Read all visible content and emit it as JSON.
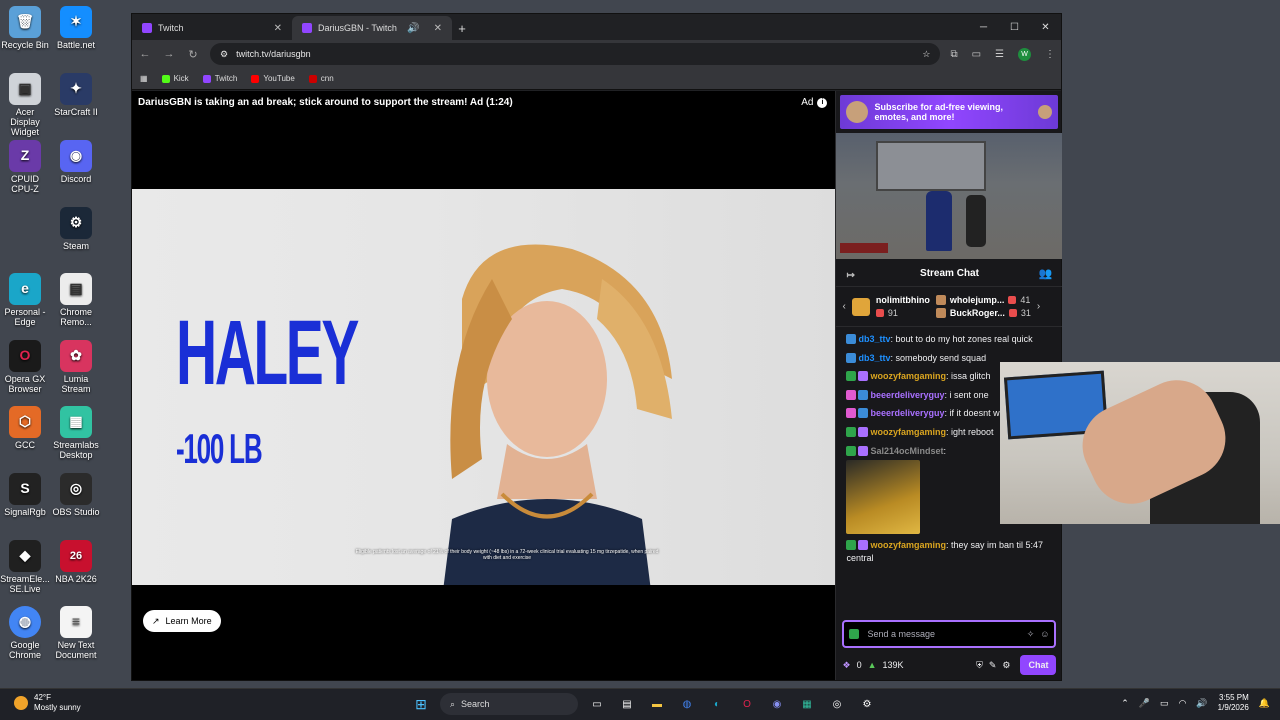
{
  "desktop": {
    "icons": [
      {
        "label": "Recycle Bin",
        "color": "#5aa0d8",
        "glyph": "🗑"
      },
      {
        "label": "Battle.net",
        "color": "#148eff",
        "glyph": "✶"
      },
      {
        "label": "Acer Display Widget",
        "color": "#cfd3d8",
        "glyph": "▣"
      },
      {
        "label": "StarCraft II",
        "color": "#2a3b66",
        "glyph": "✦"
      },
      {
        "label": "CPUID CPU-Z",
        "color": "#6a3aa8",
        "glyph": "Z"
      },
      {
        "label": "Discord",
        "color": "#5865f2",
        "glyph": "◉"
      },
      {
        "label": "Steam",
        "color": "#1b2838",
        "glyph": "⚙"
      },
      {
        "label": "Personal - Edge",
        "color": "#1aa6c9",
        "glyph": "e"
      },
      {
        "label": "Chrome Remo...",
        "color": "#ececec",
        "glyph": "▤"
      },
      {
        "label": "Opera GX Browser",
        "color": "#1a1a1a",
        "glyph": "O"
      },
      {
        "label": "Lumia Stream",
        "color": "#d8345f",
        "glyph": "✿"
      },
      {
        "label": "GCC",
        "color": "#e46a26",
        "glyph": "⬡"
      },
      {
        "label": "Streamlabs Desktop",
        "color": "#31c3a2",
        "glyph": "▦"
      },
      {
        "label": "SignalRgb",
        "color": "#222",
        "glyph": "S"
      },
      {
        "label": "OBS Studio",
        "color": "#2b2b2b",
        "glyph": "◎"
      },
      {
        "label": "StreamEle... SE.Live",
        "color": "#202020",
        "glyph": "◆"
      },
      {
        "label": "NBA 2K26",
        "color": "#c8102e",
        "glyph": "26"
      },
      {
        "label": "Google Chrome",
        "color": "#4285f4",
        "glyph": "◍"
      },
      {
        "label": "New Text Document",
        "color": "#f4f4f4",
        "glyph": "≡"
      }
    ]
  },
  "browser": {
    "tabs": [
      {
        "label": "Twitch"
      },
      {
        "label": "DariusGBN - Twitch"
      }
    ],
    "new_tab": "+",
    "address": "twitch.tv/dariusgbn",
    "bookmarks": [
      {
        "label": "Kick",
        "color": "#53fc18"
      },
      {
        "label": "Twitch",
        "color": "#9146ff"
      },
      {
        "label": "YouTube",
        "color": "#ff0000"
      },
      {
        "label": "cnn",
        "color": "#cc0000"
      }
    ],
    "profile_initial": "W"
  },
  "player": {
    "ad_notice": "DariusGBN is taking an ad break; stick around to support the stream! Ad (1:24)",
    "ad_label": "Ad",
    "ad_headline": "HALEY",
    "ad_subline": "-100 LB",
    "ad_disclaimer": "Eligible patients lost an average of 21% of their body weight (~48 lbs) in a 72-week clinical trial evaluating 15 mg tirzepatide, when paired with diet and exercise",
    "learn_more": "Learn More"
  },
  "chat": {
    "sub_banner": "Subscribe for ad-free viewing, emotes, and more!",
    "title": "Stream Chat",
    "leaderboard": {
      "top": {
        "name": "nolimitbhino",
        "count": "91"
      },
      "others": [
        {
          "name": "wholejump...",
          "count": "41"
        },
        {
          "name": "BuckRoger...",
          "count": "31"
        }
      ]
    },
    "messages": [
      {
        "user": "db3_ttv",
        "color": "#1e90ff",
        "text": "bout to do my hot zones real quick"
      },
      {
        "user": "db3_ttv",
        "color": "#1e90ff",
        "text": "somebody send squad"
      },
      {
        "user": "woozyfamgaming",
        "color": "#daa520",
        "text": "issa glitch"
      },
      {
        "user": "beeerdeliveryguy",
        "color": "#a970ff",
        "text": "i sent one"
      },
      {
        "user": "beeerdeliveryguy",
        "color": "#a970ff",
        "text": "if it doesnt work reboot?"
      },
      {
        "user": "woozyfamgaming",
        "color": "#daa520",
        "text": "ight reboot"
      },
      {
        "user": "Sal214ocMindset",
        "color": "#8a8a8a",
        "text": ""
      },
      {
        "user": "woozyfamgaming",
        "color": "#daa520",
        "text": "they say im ban til 5:47 central"
      }
    ],
    "input_placeholder": "Send a message",
    "points": "0",
    "bits": "139K",
    "chat_button": "Chat"
  },
  "taskbar": {
    "temperature": "42°F",
    "weather": "Mostly sunny",
    "search": "Search",
    "time": "3:55 PM",
    "date": "1/9/2026"
  }
}
